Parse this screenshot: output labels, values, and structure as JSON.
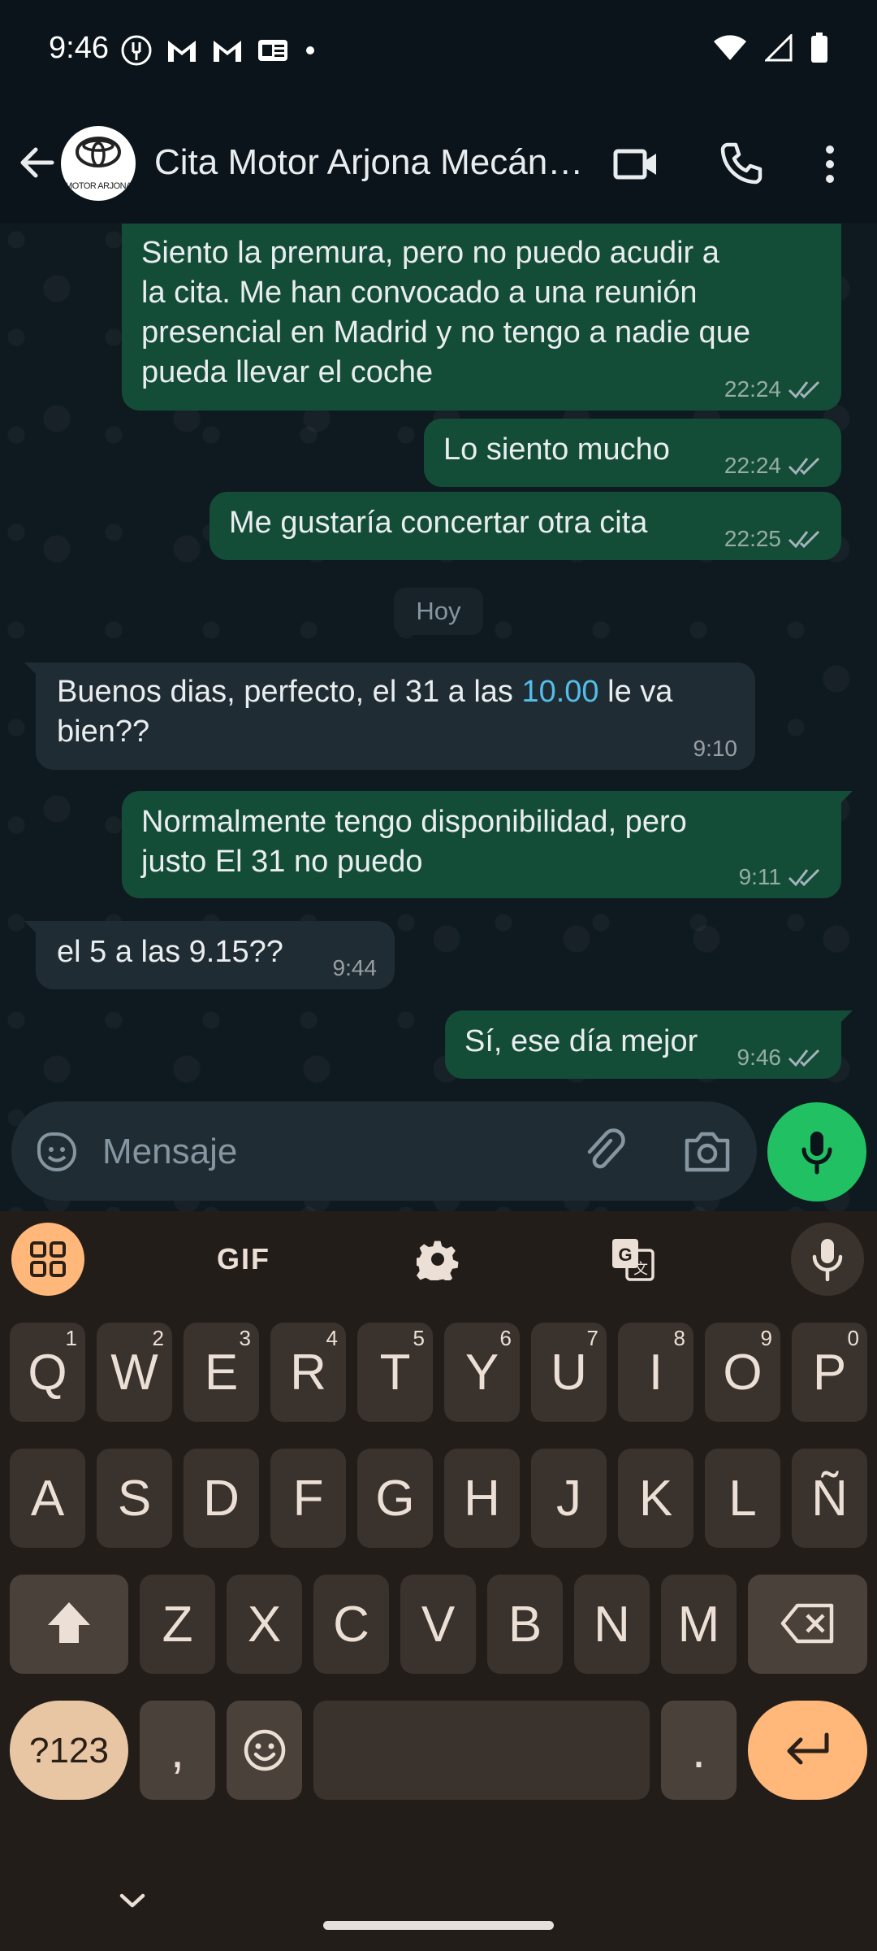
{
  "status_bar": {
    "time": "9:46",
    "notification_icons": [
      "podcast-icon",
      "gmail-icon",
      "gmail-icon",
      "news-icon",
      "dot-icon"
    ],
    "system_icons": [
      "wifi-icon",
      "signal-icon",
      "battery-icon"
    ]
  },
  "header": {
    "title": "Cita Motor Arjona Mecán…",
    "avatar_text": "MOTOR ARJONA"
  },
  "messages": [
    {
      "direction": "out",
      "lines": [
        "Siento la premura, pero no puedo acudir a",
        "la cita. Me han convocado a una reunión",
        "presencial en Madrid y no tengo a nadie que",
        "pueda llevar el coche"
      ],
      "time": "22:24",
      "read": true
    },
    {
      "direction": "out",
      "text": "Lo siento mucho",
      "time": "22:24",
      "read": true
    },
    {
      "direction": "out",
      "text": "Me gustaría concertar otra cita",
      "time": "22:25",
      "read": true
    },
    {
      "direction": "in",
      "line1_before": "Buenos dias, perfecto, el 31 a las ",
      "line1_link": "10.00",
      "line1_after": " le va",
      "line2": "bien??",
      "time": "9:10"
    },
    {
      "direction": "out",
      "lines": [
        "Normalmente tengo disponibilidad, pero",
        "justo El 31 no puedo"
      ],
      "time": "9:11",
      "read": true
    },
    {
      "direction": "in",
      "text": "el 5 a las 9.15??",
      "time": "9:44"
    },
    {
      "direction": "out",
      "text": "Sí, ese día mejor",
      "time": "9:46",
      "read": true
    }
  ],
  "day_divider": "Hoy",
  "composer": {
    "placeholder": "Mensaje"
  },
  "keyboard": {
    "toolbar": {
      "gif_label": "GIF"
    },
    "row1": [
      {
        "k": "Q",
        "h": "1"
      },
      {
        "k": "W",
        "h": "2"
      },
      {
        "k": "E",
        "h": "3"
      },
      {
        "k": "R",
        "h": "4"
      },
      {
        "k": "T",
        "h": "5"
      },
      {
        "k": "Y",
        "h": "6"
      },
      {
        "k": "U",
        "h": "7"
      },
      {
        "k": "I",
        "h": "8"
      },
      {
        "k": "O",
        "h": "9"
      },
      {
        "k": "P",
        "h": "0"
      }
    ],
    "row2": [
      "A",
      "S",
      "D",
      "F",
      "G",
      "H",
      "J",
      "K",
      "L",
      "Ñ"
    ],
    "row3": [
      "Z",
      "X",
      "C",
      "V",
      "B",
      "N",
      "M"
    ],
    "symbols_label": "?123",
    "comma": ",",
    "period": "."
  },
  "colors": {
    "outgoing_bubble": "#144d37",
    "incoming_bubble": "#202c33",
    "accent_green": "#21c063",
    "link": "#53bdeb",
    "enter_key": "#ffb77a"
  }
}
